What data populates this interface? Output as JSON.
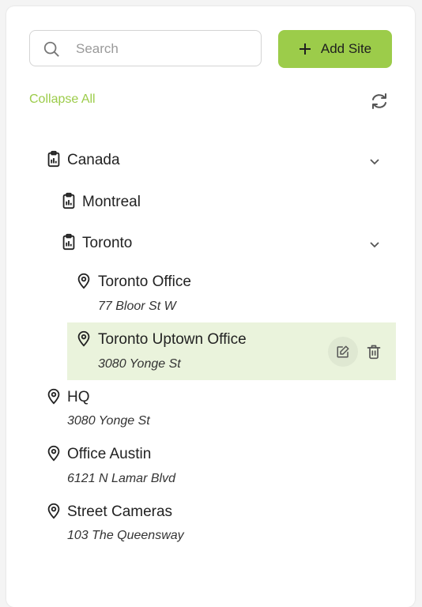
{
  "search": {
    "placeholder": "Search",
    "value": ""
  },
  "toolbar": {
    "add_label": "Add Site",
    "collapse_label": "Collapse All"
  },
  "colors": {
    "accent": "#9ccc4a",
    "selected_bg": "#eaf3dc"
  },
  "tree": {
    "canada": {
      "label": "Canada",
      "icon": "clipboard-icon",
      "expanded": true
    },
    "montreal": {
      "label": "Montreal",
      "icon": "clipboard-icon"
    },
    "toronto": {
      "label": "Toronto",
      "icon": "clipboard-icon",
      "expanded": true
    },
    "toronto_office": {
      "label": "Toronto Office",
      "address": "77 Bloor St W",
      "icon": "map-pin-icon"
    },
    "toronto_uptown": {
      "label": "Toronto Uptown Office",
      "address": "3080 Yonge St",
      "icon": "map-pin-icon",
      "selected": true
    },
    "hq": {
      "label": "HQ",
      "address": "3080 Yonge St",
      "icon": "map-pin-icon"
    },
    "austin": {
      "label": "Office Austin",
      "address": "6121 N Lamar Blvd",
      "icon": "map-pin-icon"
    },
    "street_cameras": {
      "label": "Street Cameras",
      "address": "103 The Queensway",
      "icon": "map-pin-icon"
    }
  }
}
